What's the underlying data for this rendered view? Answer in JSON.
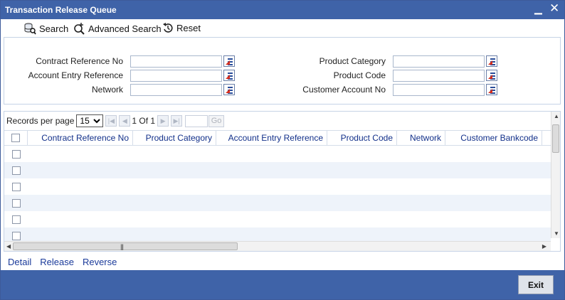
{
  "window": {
    "title": "Transaction Release Queue"
  },
  "toolbar": {
    "search_label": "Search",
    "advanced_search_label": "Advanced Search",
    "reset_label": "Reset"
  },
  "criteria": {
    "left": [
      {
        "label": "Contract Reference No",
        "value": ""
      },
      {
        "label": "Account Entry Reference",
        "value": ""
      },
      {
        "label": "Network",
        "value": ""
      }
    ],
    "right": [
      {
        "label": "Product Category",
        "value": ""
      },
      {
        "label": "Product Code",
        "value": ""
      },
      {
        "label": "Customer Account No",
        "value": ""
      }
    ]
  },
  "pager": {
    "records_per_page_label": "Records per page",
    "records_per_page_value": "15",
    "page_info": "1 Of 1",
    "go_label": "Go"
  },
  "table": {
    "columns": [
      "Contract Reference No",
      "Product Category",
      "Account Entry Reference",
      "Product Code",
      "Network",
      "Customer Bankcode"
    ]
  },
  "actions": {
    "detail_label": "Detail",
    "release_label": "Release",
    "reverse_label": "Reverse"
  },
  "footer": {
    "exit_label": "Exit"
  },
  "colors": {
    "titlebar": "#3f63a8",
    "header_text": "#12308a",
    "link": "#1a3a9a"
  }
}
